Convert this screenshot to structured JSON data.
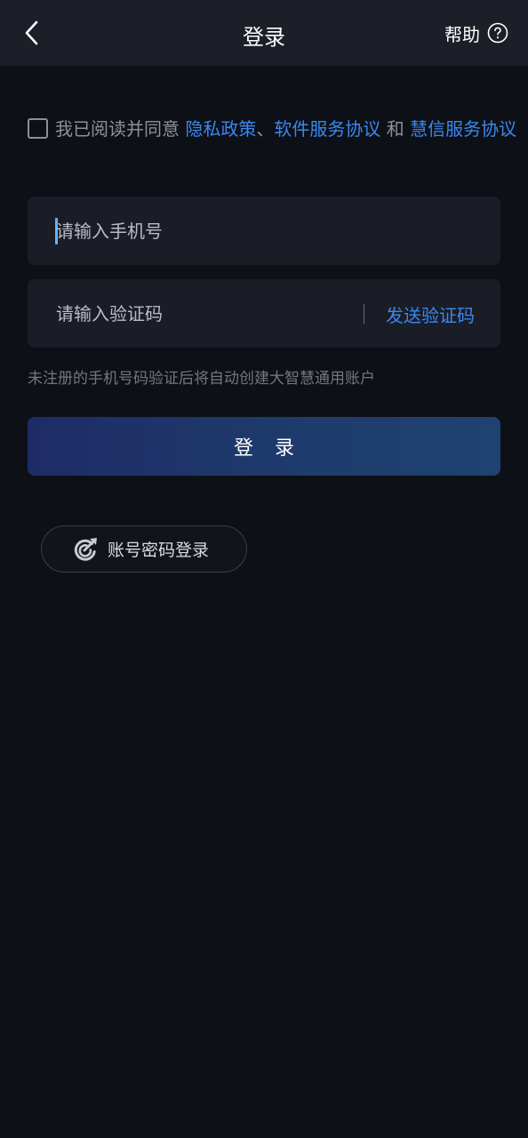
{
  "header": {
    "title": "登录",
    "help_label": "帮助"
  },
  "agreement": {
    "prefix": "我已阅读并同意 ",
    "privacy_link": "隐私政策",
    "separator": "、",
    "service_link": "软件服务协议",
    "conjunction": " 和 ",
    "huixin_link": "慧信服务协议"
  },
  "phone_field": {
    "placeholder": "请输入手机号"
  },
  "code_field": {
    "placeholder": "请输入验证码",
    "send_label": "发送验证码"
  },
  "hint": "未注册的手机号码验证后将自动创建大智慧通用账户",
  "login_button": "登录",
  "password_login": "账号密码登录",
  "colors": {
    "background": "#0e1017",
    "header": "#1c1f28",
    "field": "#1a1d26",
    "link": "#3b87ef",
    "button": "#1e3c6d"
  },
  "icons": {
    "back": "chevron-left-icon",
    "help": "question-circle-icon",
    "password_login": "arrow-target-icon"
  }
}
